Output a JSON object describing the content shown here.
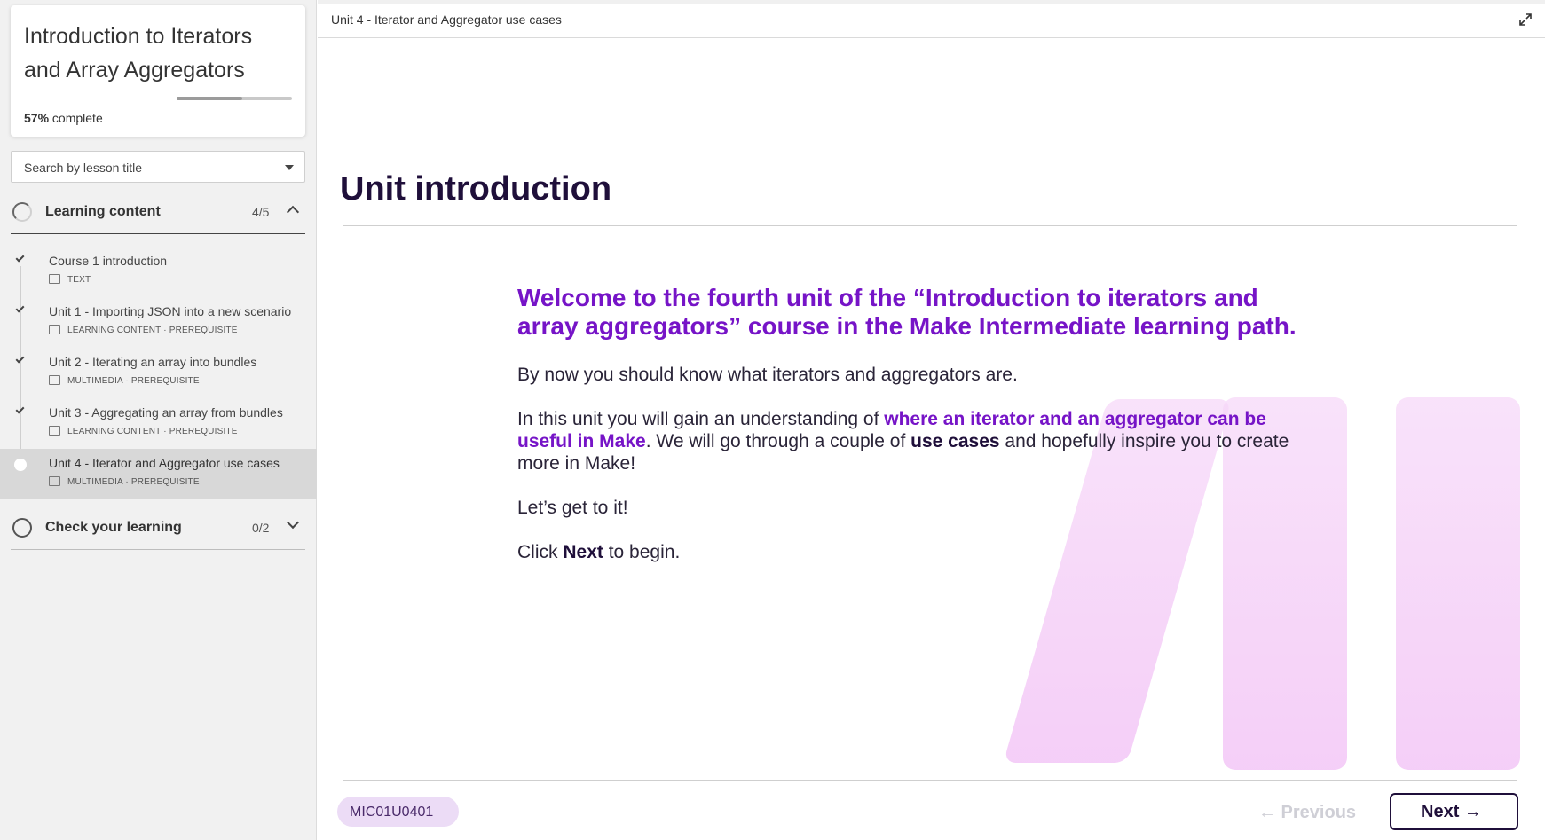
{
  "sidebar": {
    "course_title": "Introduction to Iterators and Array Aggregators",
    "progress_percent": 57,
    "progress_value": "57%",
    "progress_suffix": "complete",
    "search_placeholder": "Search by lesson title",
    "sections": [
      {
        "title": "Learning content",
        "count": "4/5",
        "expanded": true,
        "lessons": [
          {
            "title": "Course 1 introduction",
            "meta": "TEXT",
            "completed": true,
            "active": false
          },
          {
            "title": "Unit 1 - Importing JSON into a new scenario",
            "meta": "LEARNING CONTENT · PREREQUISITE",
            "completed": true,
            "active": false
          },
          {
            "title": "Unit 2 - Iterating an array into bundles",
            "meta": "MULTIMEDIA · PREREQUISITE",
            "completed": true,
            "active": false
          },
          {
            "title": "Unit 3 - Aggregating an array from bundles",
            "meta": "LEARNING CONTENT · PREREQUISITE",
            "completed": true,
            "active": false
          },
          {
            "title": "Unit 4 - Iterator and Aggregator use cases",
            "meta": "MULTIMEDIA · PREREQUISITE",
            "completed": false,
            "active": true
          }
        ]
      },
      {
        "title": "Check your learning",
        "count": "0/2",
        "expanded": false
      }
    ]
  },
  "main": {
    "topbar_title": "Unit 4 - Iterator and Aggregator use cases",
    "heading": "Unit introduction",
    "lead": "Welcome to the fourth unit of the “Introduction to iterators and array aggregators” course in the Make Intermediate learning path.",
    "p1": "By now you should know what iterators and aggregators are.",
    "p2_a": "In this unit you will gain an understanding of ",
    "p2_hl": "where an iterator and an aggregator can be useful in Make",
    "p2_b": ". We will go through a couple of ",
    "p2_bold": "use cases",
    "p2_c": " and hopefully inspire you to create more in Make!",
    "p3": "Let’s get to it!",
    "p4_a": "Click ",
    "p4_bold": "Next",
    "p4_b": " to begin.",
    "code": "MIC01U0401",
    "prev_label": "← Previous",
    "next_label": "Next →"
  },
  "colors": {
    "accent": "#7614c7",
    "heading": "#1f0f3a",
    "badge_bg": "#ecdcf6",
    "deco": "#f4ccf7"
  }
}
